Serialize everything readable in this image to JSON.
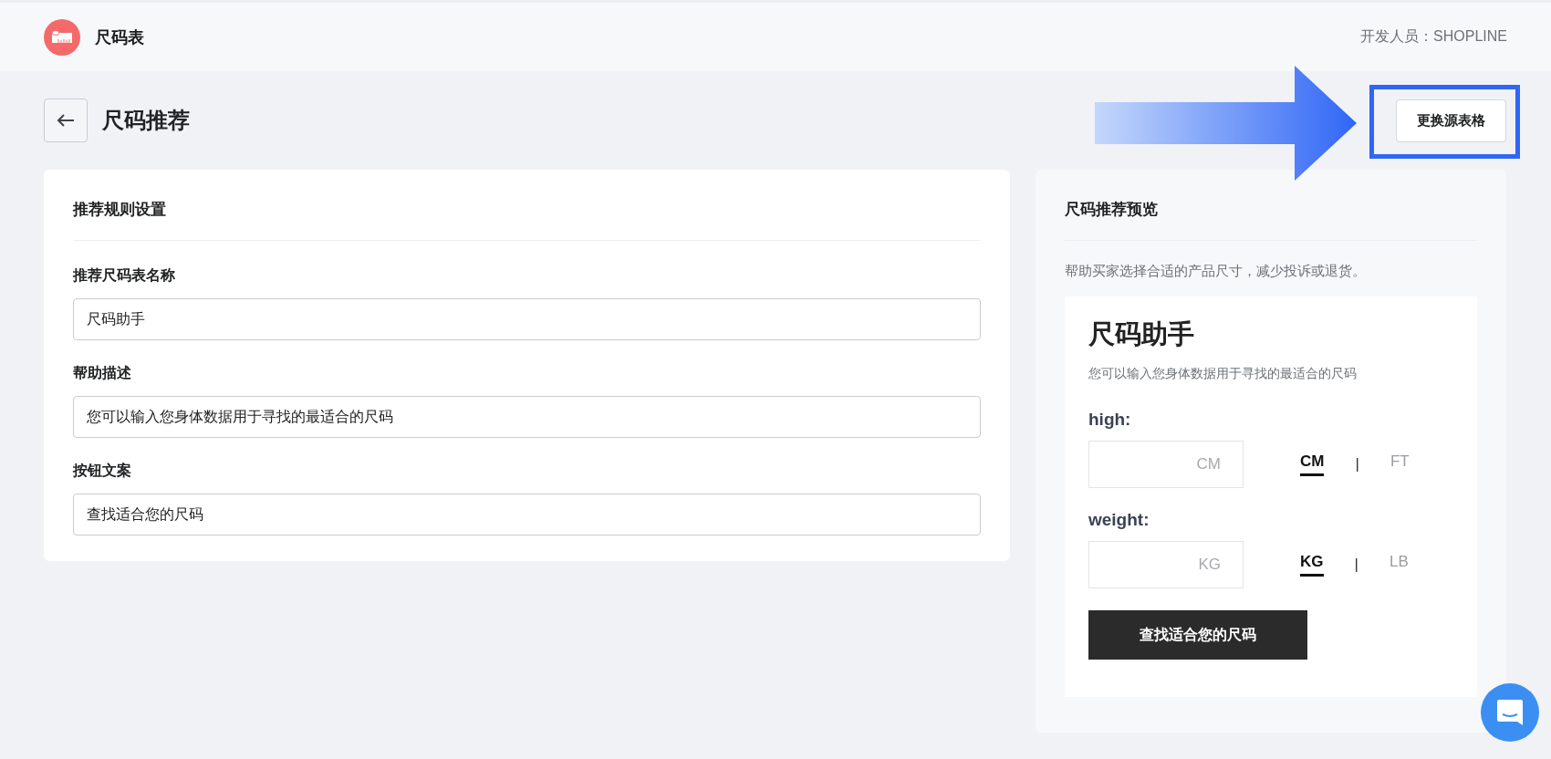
{
  "header": {
    "app_name": "尺码表",
    "developer": "开发人员：SHOPLINE"
  },
  "page": {
    "title": "尺码推荐",
    "replace_button": "更换源表格"
  },
  "settings": {
    "title": "推荐规则设置",
    "fields": [
      {
        "label": "推荐尺码表名称",
        "value": "尺码助手"
      },
      {
        "label": "帮助描述",
        "value": "您可以输入您身体数据用于寻找的最适合的尺码"
      },
      {
        "label": "按钮文案",
        "value": "查找适合您的尺码"
      }
    ]
  },
  "preview": {
    "title": "尺码推荐预览",
    "description": "帮助买家选择合适的产品尺寸，减少投诉或退货。",
    "widget": {
      "title": "尺码助手",
      "subtitle": "您可以输入您身体数据用于寻找的最适合的尺码",
      "measures": [
        {
          "label": "high:",
          "placeholder": "CM",
          "separator": "|",
          "units": [
            {
              "label": "CM",
              "selected": true
            },
            {
              "label": "FT",
              "selected": false
            }
          ]
        },
        {
          "label": "weight:",
          "placeholder": "KG",
          "separator": "|",
          "units": [
            {
              "label": "KG",
              "selected": true
            },
            {
              "label": "LB",
              "selected": false
            }
          ]
        }
      ],
      "button": "查找适合您的尺码"
    }
  }
}
